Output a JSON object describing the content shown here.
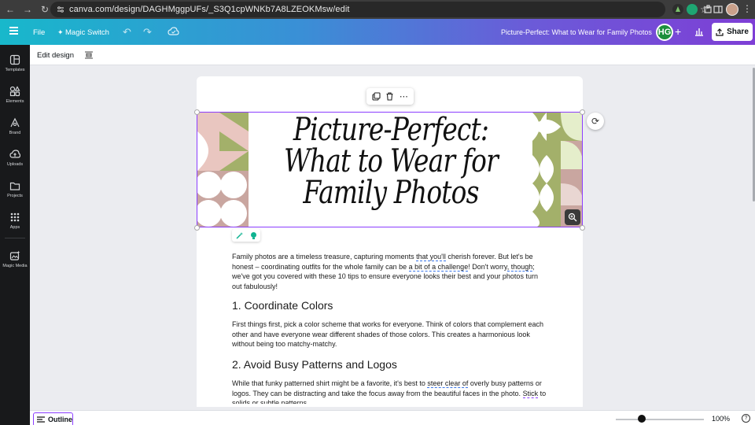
{
  "browser": {
    "url": "canva.com/design/DAGHMggpUFs/_S3Q1cpWNKb7A8LZEOKMsw/edit"
  },
  "toolbar": {
    "file_label": "File",
    "magic_switch_label": "Magic Switch",
    "design_title": "Picture-Perfect: What to Wear for Family Photos",
    "avatar_initials": "HG",
    "share_label": "Share"
  },
  "subbar": {
    "edit_design_label": "Edit design"
  },
  "sidebar": {
    "items": [
      {
        "label": "Templates"
      },
      {
        "label": "Elements"
      },
      {
        "label": "Brand"
      },
      {
        "label": "Uploads"
      },
      {
        "label": "Projects"
      },
      {
        "label": "Apps"
      },
      {
        "label": "Magic Media"
      }
    ]
  },
  "canvas": {
    "banner_title": "Picture-Perfect: What to Wear for Family Photos",
    "intro_paragraph_parts": [
      "Family photos are a timeless treasure, capturing moments ",
      "that you'll",
      " cherish forever. But let's be honest – coordinating outfits for the whole family can be ",
      "a bit of a challenge",
      "! Don't worry",
      ", though",
      "; we've got you covered with these 10 tips to ensure everyone looks their best and your photos turn out fabulously!"
    ],
    "heading_1": "1. Coordinate Colors",
    "paragraph_1": "First things first, pick a color scheme that works for everyone. Think of colors that complement each other and have everyone wear different shades of those colors. This creates a harmonious look without being too matchy-matchy.",
    "heading_2": "2. Avoid Busy Patterns and Logos",
    "paragraph_2_parts": [
      "While that funky patterned shirt might be a favorite, it's best to ",
      "steer clear of",
      " overly busy patterns or logos. They can be distracting and take the focus away from the beautiful faces in the photo. ",
      "Stick",
      " to solids or subtle patterns."
    ]
  },
  "bottombar": {
    "outline_label": "Outline",
    "zoom_percent": "100%",
    "zoom_value": 100
  },
  "colors": {
    "accent": "#8b3dff",
    "sidebar_bg": "#18191b",
    "pattern_pink": "#e9c6c0",
    "pattern_green": "#a3b06a",
    "pattern_mauve": "#c9a6a0"
  }
}
